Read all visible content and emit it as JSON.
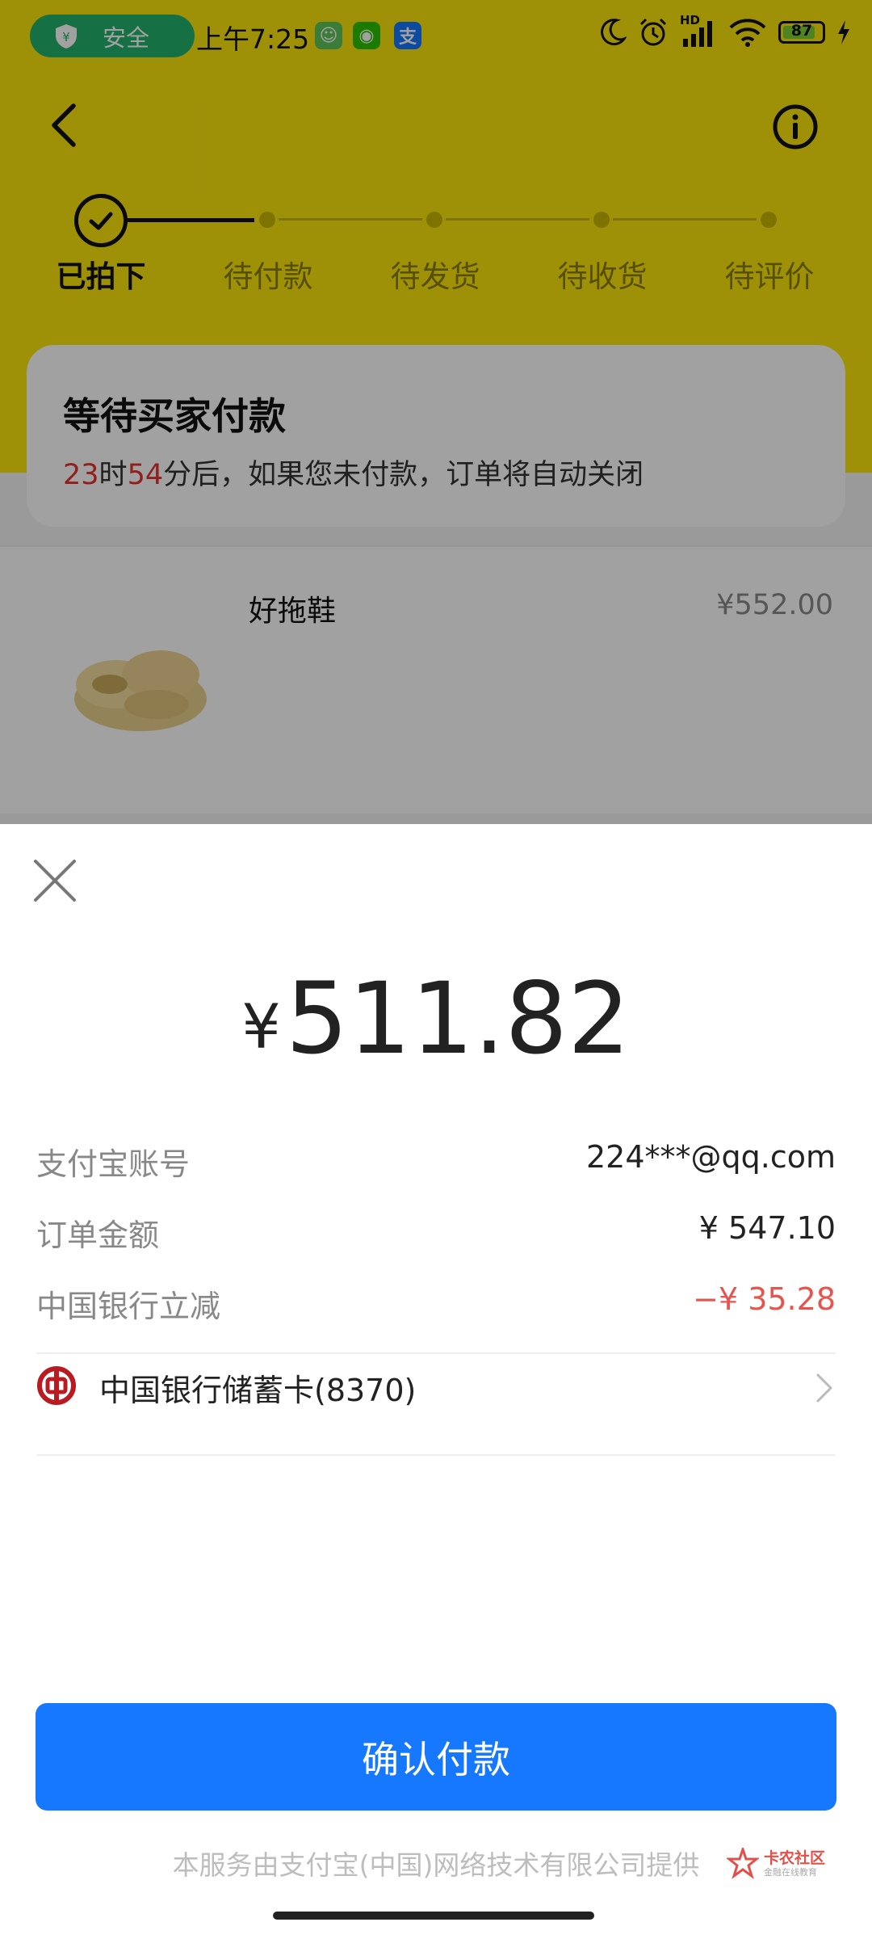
{
  "status_bar": {
    "security_label": "安全",
    "time": "上午7:25",
    "network_label": "HD",
    "battery_level": "87",
    "notification_icons": [
      "app-icon",
      "wechat-icon",
      "alipay-icon"
    ]
  },
  "header": {
    "back_icon": "back-arrow-icon",
    "info_icon": "info-icon"
  },
  "progress": {
    "steps": [
      "已拍下",
      "待付款",
      "待发货",
      "待收货",
      "待评价"
    ],
    "current_index": 0
  },
  "status_card": {
    "title": "等待买家付款",
    "hours": "23",
    "hours_unit": "时",
    "minutes": "54",
    "minutes_suffix": "分后，如果您未付款，订单将自动关闭"
  },
  "product": {
    "name": "好拖鞋",
    "price": "¥552.00"
  },
  "payment_sheet": {
    "currency_symbol": "¥",
    "amount": "511.82",
    "rows": [
      {
        "label": "支付宝账号",
        "value": "224***@qq.com"
      },
      {
        "label": "订单金额",
        "value": "¥ 547.10"
      },
      {
        "label": "中国银行立减",
        "value": "−¥ 35.28"
      }
    ],
    "payment_method": "中国银行储蓄卡(8370)",
    "confirm_label": "确认付款",
    "footer_note": "本服务由支付宝(中国)网络技术有限公司提供"
  },
  "watermark": {
    "title": "卡农社区",
    "subtitle": "金融在线教育"
  },
  "colors": {
    "brand_yellow": "#fbe50c",
    "primary_blue": "#1677ff",
    "discount_red": "#e5544d",
    "security_green": "#22b36a"
  }
}
